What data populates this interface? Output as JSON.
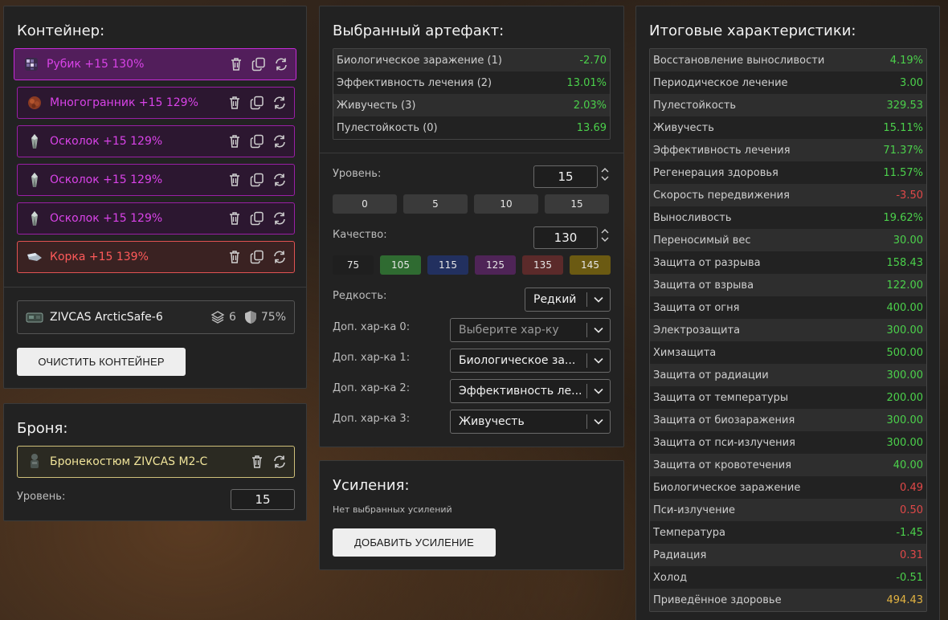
{
  "container": {
    "title": "Контейнер:",
    "artifacts": [
      {
        "label": "Рубик +15 130%",
        "icon": "rubik-artifact-icon",
        "selected": true
      },
      {
        "label": "Многогранник +15 129%",
        "icon": "polyhedron-artifact-icon"
      },
      {
        "label": "Осколок +15 129%",
        "icon": "shard-artifact-icon"
      },
      {
        "label": "Осколок +15 129%",
        "icon": "shard-artifact-icon"
      },
      {
        "label": "Осколок +15 129%",
        "icon": "shard-artifact-icon"
      },
      {
        "label": "Корка +15 139%",
        "icon": "crust-artifact-icon"
      }
    ],
    "container_item": {
      "name": "ZIVCAS ArcticSafe-6",
      "slots": "6",
      "protection": "75%"
    },
    "clear_button": "ОЧИСТИТЬ КОНТЕЙНЕР"
  },
  "armor": {
    "title": "Броня:",
    "item": "Бронекостюм ZIVCAS M2-C",
    "level_label": "Уровень:",
    "level_value": "15"
  },
  "artifact": {
    "title": "Выбранный артефакт:",
    "stats": [
      {
        "name": "Биологическое заражение (1)",
        "value": "-2.70",
        "tone": "pos"
      },
      {
        "name": "Эффективность лечения (2)",
        "value": "13.01%",
        "tone": "pos"
      },
      {
        "name": "Живучесть (3)",
        "value": "2.03%",
        "tone": "pos"
      },
      {
        "name": "Пулестойкость (0)",
        "value": "13.69",
        "tone": "pos"
      }
    ],
    "level_label": "Уровень:",
    "level_value": "15",
    "level_presets": [
      "0",
      "5",
      "10",
      "15"
    ],
    "quality_label": "Качество:",
    "quality_value": "130",
    "quality_presets": [
      {
        "label": "75",
        "color": "#1f1f1f"
      },
      {
        "label": "105",
        "color": "#2f6b31"
      },
      {
        "label": "115",
        "color": "#22305f"
      },
      {
        "label": "125",
        "color": "#4f2457"
      },
      {
        "label": "135",
        "color": "#5b2a2a"
      },
      {
        "label": "145",
        "color": "#6b5a12"
      }
    ],
    "rarity_label": "Редкость:",
    "rarity_value": "Редкий",
    "extra": [
      {
        "label": "Доп. хар-ка 0:",
        "value": "Выберите хар-ку",
        "placeholder": true
      },
      {
        "label": "Доп. хар-ка 1:",
        "value": "Биологическое за..."
      },
      {
        "label": "Доп. хар-ка 2:",
        "value": "Эффективность ле..."
      },
      {
        "label": "Доп. хар-ка 3:",
        "value": "Живучесть"
      }
    ]
  },
  "boosts": {
    "title": "Усиления:",
    "empty_text": "Нет выбранных усилений",
    "add_button": "ДОБАВИТЬ УСИЛЕНИЕ"
  },
  "totals": {
    "title": "Итоговые характеристики:",
    "rows": [
      {
        "name": "Восстановление выносливости",
        "value": "4.19%",
        "tone": "pos"
      },
      {
        "name": "Периодическое лечение",
        "value": "3.00",
        "tone": "pos"
      },
      {
        "name": "Пулестойкость",
        "value": "329.53",
        "tone": "pos"
      },
      {
        "name": "Живучесть",
        "value": "15.11%",
        "tone": "pos"
      },
      {
        "name": "Эффективность лечения",
        "value": "71.37%",
        "tone": "pos"
      },
      {
        "name": "Регенерация здоровья",
        "value": "11.57%",
        "tone": "pos"
      },
      {
        "name": "Скорость передвижения",
        "value": "-3.50",
        "tone": "neg"
      },
      {
        "name": "Выносливость",
        "value": "19.62%",
        "tone": "pos"
      },
      {
        "name": "Переносимый вес",
        "value": "30.00",
        "tone": "pos"
      },
      {
        "name": "Защита от разрыва",
        "value": "158.43",
        "tone": "pos"
      },
      {
        "name": "Защита от взрыва",
        "value": "122.00",
        "tone": "pos"
      },
      {
        "name": "Защита от огня",
        "value": "400.00",
        "tone": "pos"
      },
      {
        "name": "Электрозащита",
        "value": "300.00",
        "tone": "pos"
      },
      {
        "name": "Химзащита",
        "value": "500.00",
        "tone": "pos"
      },
      {
        "name": "Защита от радиации",
        "value": "300.00",
        "tone": "pos"
      },
      {
        "name": "Защита от температуры",
        "value": "200.00",
        "tone": "pos"
      },
      {
        "name": "Защита от биозаражения",
        "value": "300.00",
        "tone": "pos"
      },
      {
        "name": "Защита от пси-излучения",
        "value": "300.00",
        "tone": "pos"
      },
      {
        "name": "Защита от кровотечения",
        "value": "40.00",
        "tone": "pos"
      },
      {
        "name": "Биологическое заражение",
        "value": "0.49",
        "tone": "neg"
      },
      {
        "name": "Пси-излучение",
        "value": "0.50",
        "tone": "neg"
      },
      {
        "name": "Температура",
        "value": "-1.45",
        "tone": "pos"
      },
      {
        "name": "Радиация",
        "value": "0.31",
        "tone": "neg"
      },
      {
        "name": "Холод",
        "value": "-0.51",
        "tone": "pos"
      },
      {
        "name": "Приведённое здоровье",
        "value": "494.43",
        "tone": "gold"
      }
    ]
  }
}
